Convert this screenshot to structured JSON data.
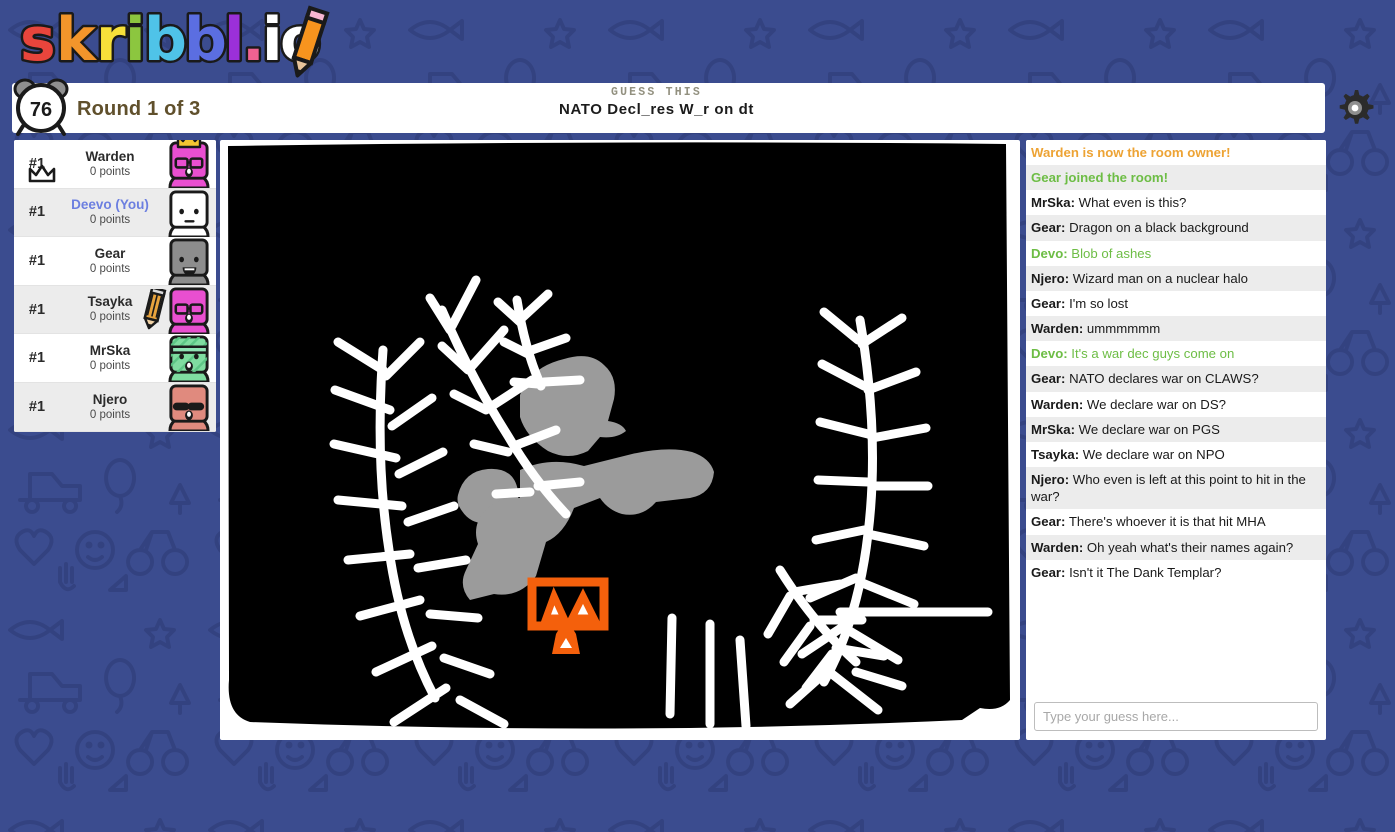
{
  "app": {
    "title": "skribbl.io",
    "logo_letters": [
      {
        "ch": "s",
        "color": "#e8453c"
      },
      {
        "ch": "k",
        "color": "#f3952b"
      },
      {
        "ch": "r",
        "color": "#f7e03a"
      },
      {
        "ch": "i",
        "color": "#8cc63f"
      },
      {
        "ch": "b",
        "color": "#4fc3e8"
      },
      {
        "ch": "b",
        "color": "#5b6ee1"
      },
      {
        "ch": "l",
        "color": "#9b30d9"
      },
      {
        "ch": ".",
        "color": "#f06292"
      },
      {
        "ch": "i",
        "color": "#ffffff"
      },
      {
        "ch": "o",
        "color": "#ffffff"
      }
    ]
  },
  "header": {
    "timer": "76",
    "round_label": "Round 1 of 3",
    "guess_this_label": "GUESS THIS",
    "word_hint": "NATO Decl_res W_r on dt",
    "settings_icon": "gear-icon"
  },
  "players": [
    {
      "rank": "#1",
      "name": "Warden",
      "points": "0 points",
      "is_you": false,
      "owner": true,
      "drawing": false,
      "avatar": {
        "body": "#e94fd0",
        "face": "#e94fd0",
        "glasses": true,
        "sunglasses": false,
        "headband": false,
        "stripes": false,
        "crown": true,
        "mouth": "o"
      }
    },
    {
      "rank": "#1",
      "name": "Deevo (You)",
      "points": "0 points",
      "is_you": true,
      "owner": false,
      "drawing": false,
      "avatar": {
        "body": "#ffffff",
        "face": "#ffffff",
        "glasses": false,
        "sunglasses": false,
        "headband": false,
        "stripes": false,
        "crown": false,
        "mouth": "flat"
      }
    },
    {
      "rank": "#1",
      "name": "Gear",
      "points": "0 points",
      "is_you": false,
      "owner": false,
      "drawing": false,
      "avatar": {
        "body": "#8d8d8d",
        "face": "#8d8d8d",
        "glasses": false,
        "sunglasses": false,
        "headband": false,
        "stripes": false,
        "crown": false,
        "mouth": "open"
      }
    },
    {
      "rank": "#1",
      "name": "Tsayka",
      "points": "0 points",
      "is_you": false,
      "owner": false,
      "drawing": true,
      "avatar": {
        "body": "#e94fd0",
        "face": "#e94fd0",
        "glasses": true,
        "sunglasses": false,
        "headband": false,
        "stripes": false,
        "crown": false,
        "mouth": "o"
      }
    },
    {
      "rank": "#1",
      "name": "MrSka",
      "points": "0 points",
      "is_you": false,
      "owner": false,
      "drawing": false,
      "avatar": {
        "body": "#7fdca0",
        "face": "#7fdca0",
        "glasses": false,
        "sunglasses": false,
        "headband": true,
        "stripes": true,
        "crown": false,
        "mouth": "o"
      }
    },
    {
      "rank": "#1",
      "name": "Njero",
      "points": "0 points",
      "is_you": false,
      "owner": false,
      "drawing": false,
      "avatar": {
        "body": "#e08a7e",
        "face": "#e08a7e",
        "glasses": false,
        "sunglasses": true,
        "headband": false,
        "stripes": false,
        "crown": false,
        "mouth": "o"
      }
    }
  ],
  "chat": {
    "messages": [
      {
        "type": "system-owner",
        "text": "Warden is now the room owner!"
      },
      {
        "type": "system-join",
        "text": "Gear joined the room!"
      },
      {
        "type": "msg",
        "who": "MrSka",
        "text": "What even is this?"
      },
      {
        "type": "msg",
        "who": "Gear",
        "text": "Dragon on a black background"
      },
      {
        "type": "correct",
        "who": "Devo",
        "text": "Blob of ashes"
      },
      {
        "type": "msg",
        "who": "Njero",
        "text": "Wizard man on a nuclear halo"
      },
      {
        "type": "msg",
        "who": "Gear",
        "text": "I'm so lost"
      },
      {
        "type": "msg",
        "who": "Warden",
        "text": "ummmmmm"
      },
      {
        "type": "correct",
        "who": "Devo",
        "text": "It's a war dec guys come on"
      },
      {
        "type": "msg",
        "who": "Gear",
        "text": "NATO declares war on CLAWS?"
      },
      {
        "type": "msg",
        "who": "Warden",
        "text": "We declare war on DS?"
      },
      {
        "type": "msg",
        "who": "MrSka",
        "text": "We declare war on PGS"
      },
      {
        "type": "msg",
        "who": "Tsayka",
        "text": "We declare war on NPO"
      },
      {
        "type": "msg",
        "who": "Njero",
        "text": "Who even is left at this point to hit in the war?"
      },
      {
        "type": "msg",
        "who": "Gear",
        "text": "There's whoever it is that hit MHA"
      },
      {
        "type": "msg",
        "who": "Warden",
        "text": "Oh yeah what's their names again?"
      },
      {
        "type": "msg",
        "who": "Gear",
        "text": "Isn't it The Dank Templar?"
      }
    ],
    "input_placeholder": "Type your guess here...",
    "input_value": ""
  },
  "canvas": {
    "background_fill": "#000000",
    "stroke_white": "#ffffff",
    "blob_gray": "#9b9b9b",
    "accent_orange": "#f4600c"
  },
  "colors": {
    "page_bg": "#3b4c8f",
    "doodle": "#334280",
    "panel": "#ffffff",
    "row_alt": "#ececec",
    "you_name": "#6c7fe0",
    "system_owner": "#eda334",
    "system_join": "#6dbd45",
    "round_text": "#60502c"
  }
}
